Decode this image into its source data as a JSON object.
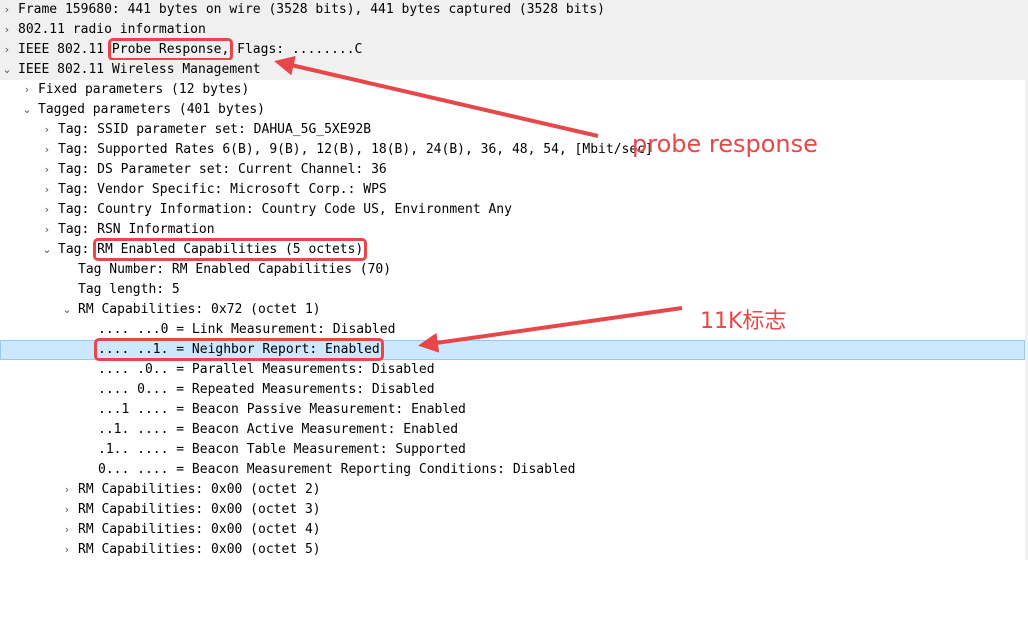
{
  "rows": [
    {
      "twisty": "›",
      "text": "Frame 159680: 441 bytes on wire (3528 bits), 441 bytes captured (3528 bits)"
    },
    {
      "twisty": "›",
      "text": "802.11 radio information"
    },
    {
      "twisty": "›",
      "pre": "IEEE 802.11 ",
      "hl": "Probe Response,",
      "post": " Flags: ........C"
    },
    {
      "twisty": "⌄",
      "text": "IEEE 802.11 Wireless Management"
    },
    {
      "twisty": "›",
      "text": "Fixed parameters (12 bytes)"
    },
    {
      "twisty": "⌄",
      "text": "Tagged parameters (401 bytes)"
    },
    {
      "twisty": "›",
      "text": "Tag: SSID parameter set: DAHUA_5G_5XE92B"
    },
    {
      "twisty": "›",
      "text": "Tag: Supported Rates 6(B), 9(B), 12(B), 18(B), 24(B), 36, 48, 54, [Mbit/sec]"
    },
    {
      "twisty": "›",
      "text": "Tag: DS Parameter set: Current Channel: 36"
    },
    {
      "twisty": "›",
      "text": "Tag: Vendor Specific: Microsoft Corp.: WPS"
    },
    {
      "twisty": "›",
      "text": "Tag: Country Information: Country Code US, Environment Any"
    },
    {
      "twisty": "›",
      "text": "Tag: RSN Information"
    },
    {
      "twisty": "⌄",
      "pre": "Tag: ",
      "hl": "RM Enabled Capabilities (5 octets)",
      "post": ""
    },
    {
      "twisty": "",
      "text": "Tag Number: RM Enabled Capabilities (70)"
    },
    {
      "twisty": "",
      "text": "Tag length: 5"
    },
    {
      "twisty": "⌄",
      "text": "RM Capabilities: 0x72 (octet 1)"
    },
    {
      "twisty": "",
      "text": ".... ...0 = Link Measurement: Disabled"
    },
    {
      "twisty": "",
      "hl": ".... ..1. = Neighbor Report: Enabled"
    },
    {
      "twisty": "",
      "text": ".... .0.. = Parallel Measurements: Disabled"
    },
    {
      "twisty": "",
      "text": ".... 0... = Repeated Measurements: Disabled"
    },
    {
      "twisty": "",
      "text": "...1 .... = Beacon Passive Measurement: Enabled"
    },
    {
      "twisty": "",
      "text": "..1. .... = Beacon Active Measurement: Enabled"
    },
    {
      "twisty": "",
      "text": ".1.. .... = Beacon Table Measurement: Supported"
    },
    {
      "twisty": "",
      "text": "0... .... = Beacon Measurement Reporting Conditions: Disabled"
    },
    {
      "twisty": "›",
      "text": "RM Capabilities: 0x00 (octet 2)"
    },
    {
      "twisty": "›",
      "text": "RM Capabilities: 0x00 (octet 3)"
    },
    {
      "twisty": "›",
      "text": "RM Capabilities: 0x00 (octet 4)"
    },
    {
      "twisty": "›",
      "text": "RM Capabilities: 0x00 (octet 5)"
    }
  ],
  "annotations": {
    "probe": "probe response",
    "k11": "11K标志"
  },
  "colors": {
    "annotation": "#e8474a",
    "selection": "#cce8ff",
    "header_bg": "#f0f0f0"
  }
}
